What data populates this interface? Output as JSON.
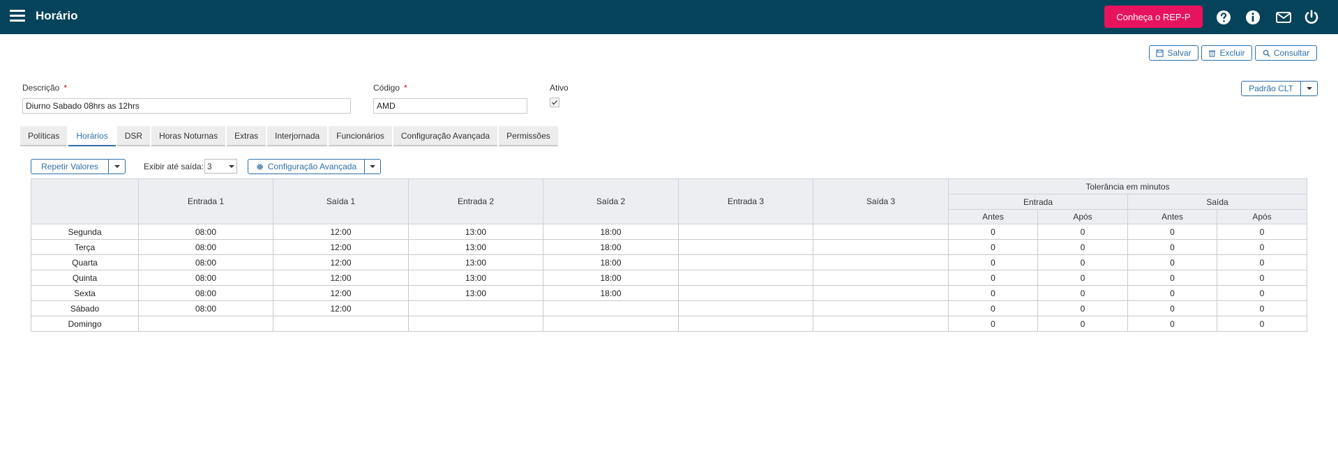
{
  "header": {
    "title": "Horário",
    "rep_button": "Conheça o REP-P",
    "icons": [
      "menu-icon",
      "help-icon",
      "info-icon",
      "mail-icon",
      "power-icon"
    ]
  },
  "actions": {
    "save": "Salvar",
    "delete": "Excluir",
    "query": "Consultar"
  },
  "form": {
    "descricao_label": "Descrição",
    "descricao_value": "Diurno Sabado 08hrs as 12hrs",
    "codigo_label": "Código",
    "codigo_value": "AMD",
    "ativo_label": "Ativo",
    "ativo_checked": true,
    "required_mark": "*",
    "padrao_button": "Padrão CLT"
  },
  "tabs": [
    {
      "label": "Políticas"
    },
    {
      "label": "Horários",
      "active": true
    },
    {
      "label": "DSR"
    },
    {
      "label": "Horas Noturnas"
    },
    {
      "label": "Extras"
    },
    {
      "label": "Interjornada"
    },
    {
      "label": "Funcionários"
    },
    {
      "label": "Configuração Avançada"
    },
    {
      "label": "Permissões"
    }
  ],
  "toolbar": {
    "repetir_label": "Repetir Valores",
    "exibir_label": "Exibir até saída:",
    "exibir_value": "3",
    "config_label": "Configuração Avançada"
  },
  "table": {
    "columns": [
      "Entrada 1",
      "Saída 1",
      "Entrada 2",
      "Saída 2",
      "Entrada 3",
      "Saída 3"
    ],
    "tolerancia_header": "Tolerância em minutos",
    "tol_groups": [
      "Entrada",
      "Saída"
    ],
    "tol_sub": [
      "Antes",
      "Após",
      "Antes",
      "Após"
    ],
    "rows": [
      [
        "Segunda",
        "08:00",
        "12:00",
        "13:00",
        "18:00",
        "",
        "",
        "0",
        "0",
        "0",
        "0"
      ],
      [
        "Terça",
        "08:00",
        "12:00",
        "13:00",
        "18:00",
        "",
        "",
        "0",
        "0",
        "0",
        "0"
      ],
      [
        "Quarta",
        "08:00",
        "12:00",
        "13:00",
        "18:00",
        "",
        "",
        "0",
        "0",
        "0",
        "0"
      ],
      [
        "Quinta",
        "08:00",
        "12:00",
        "13:00",
        "18:00",
        "",
        "",
        "0",
        "0",
        "0",
        "0"
      ],
      [
        "Sexta",
        "08:00",
        "12:00",
        "13:00",
        "18:00",
        "",
        "",
        "0",
        "0",
        "0",
        "0"
      ],
      [
        "Sábado",
        "08:00",
        "12:00",
        "",
        "",
        "",
        "",
        "0",
        "0",
        "0",
        "0"
      ],
      [
        "Domingo",
        "",
        "",
        "",
        "",
        "",
        "",
        "0",
        "0",
        "0",
        "0"
      ]
    ]
  },
  "colors": {
    "header_bg": "#05435a",
    "accent": "#e8135f",
    "link": "#2f6fa8"
  }
}
